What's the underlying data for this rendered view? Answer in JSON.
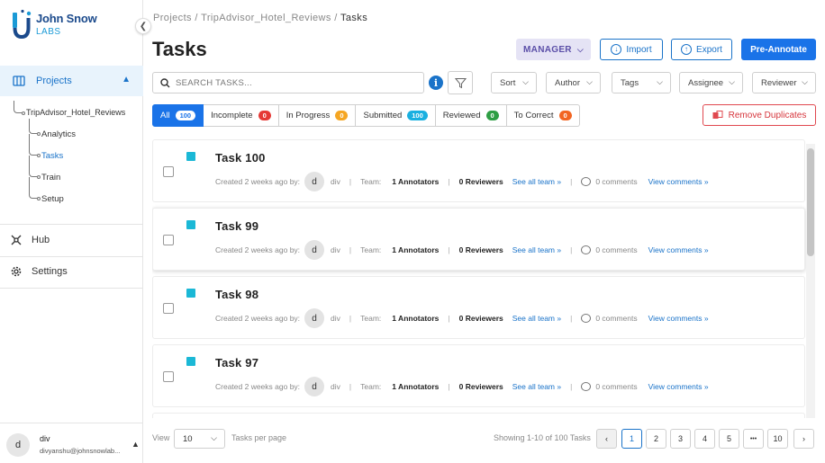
{
  "brand": {
    "line1": "John Snow",
    "line2": "LABS"
  },
  "sidebar": {
    "projects_label": "Projects",
    "project_name": "TripAdvisor_Hotel_Reviews",
    "sub_items": [
      {
        "label": "Analytics",
        "active": false
      },
      {
        "label": "Tasks",
        "active": true
      },
      {
        "label": "Train",
        "active": false
      },
      {
        "label": "Setup",
        "active": false
      }
    ],
    "hub_label": "Hub",
    "settings_label": "Settings",
    "user": {
      "initial": "d",
      "name": "div",
      "email": "divyanshu@johnsnowlab..."
    }
  },
  "header": {
    "breadcrumb": {
      "part1": "Projects",
      "sep": " / ",
      "part2": "TripAdvisor_Hotel_Reviews",
      "current": "Tasks"
    },
    "title": "Tasks",
    "manager_label": "MANAGER",
    "import_label": "Import",
    "export_label": "Export",
    "preannotate_label": "Pre-Annotate"
  },
  "search": {
    "placeholder": "SEARCH TASKS..."
  },
  "filters": [
    {
      "label": "Sort"
    },
    {
      "label": "Author"
    },
    {
      "label": "Tags"
    },
    {
      "label": "Assignee"
    },
    {
      "label": "Reviewer"
    }
  ],
  "status_tabs": [
    {
      "label": "All",
      "count": "100",
      "color": "#ffffff",
      "active": true
    },
    {
      "label": "Incomplete",
      "count": "0",
      "color": "#e53935",
      "active": false
    },
    {
      "label": "In Progress",
      "count": "0",
      "color": "#f5a623",
      "active": false
    },
    {
      "label": "Submitted",
      "count": "100",
      "color": "#1ab0e0",
      "active": false
    },
    {
      "label": "Reviewed",
      "count": "0",
      "color": "#2e9e44",
      "active": false
    },
    {
      "label": "To Correct",
      "count": "0",
      "color": "#f26522",
      "active": false
    }
  ],
  "remove_duplicates_label": "Remove Duplicates",
  "task_meta": {
    "created": "Created 2 weeks ago by:",
    "avatar": "d",
    "author": "div",
    "sep": "|",
    "team_label": "Team:",
    "annotators": "1 Annotators",
    "reviewers": "0 Reviewers",
    "see_all": "See all team »",
    "comments": "0 comments",
    "view_comments": "View comments »"
  },
  "tasks": [
    {
      "title": "Task 100"
    },
    {
      "title": "Task 99"
    },
    {
      "title": "Task 98"
    },
    {
      "title": "Task 97"
    }
  ],
  "footer": {
    "view_label": "View",
    "per_page_value": "10",
    "per_page_label": "Tasks per page",
    "showing": "Showing 1-10 of 100 Tasks",
    "pages": [
      "1",
      "2",
      "3",
      "4",
      "5",
      "•••",
      "10"
    ],
    "prev": "‹",
    "next": "›"
  }
}
